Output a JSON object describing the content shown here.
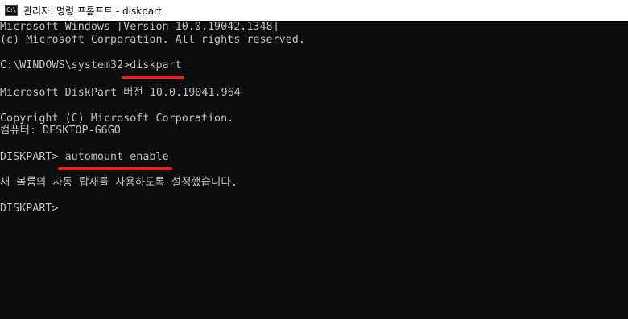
{
  "window": {
    "title": "관리자: 명령 프롬프트 - diskpart",
    "icon": "cmd-icon"
  },
  "console": {
    "lines": [
      "Microsoft Windows [Version 10.0.19042.1348]",
      "(c) Microsoft Corporation. All rights reserved.",
      "",
      "C:\\WINDOWS\\system32>diskpart",
      "",
      "Microsoft DiskPart 버전 10.0.19041.964",
      "",
      "Copyright (C) Microsoft Corporation.",
      "컴퓨터: DESKTOP-G6GO",
      "",
      "DISKPART> automount enable",
      "",
      "새 볼륨의 자동 탑재를 사용하도록 설정했습니다.",
      "",
      "DISKPART>"
    ],
    "highlight_color": "#e2231a",
    "text_color": "#c0c0c0",
    "background_color": "#0c0c0c"
  }
}
